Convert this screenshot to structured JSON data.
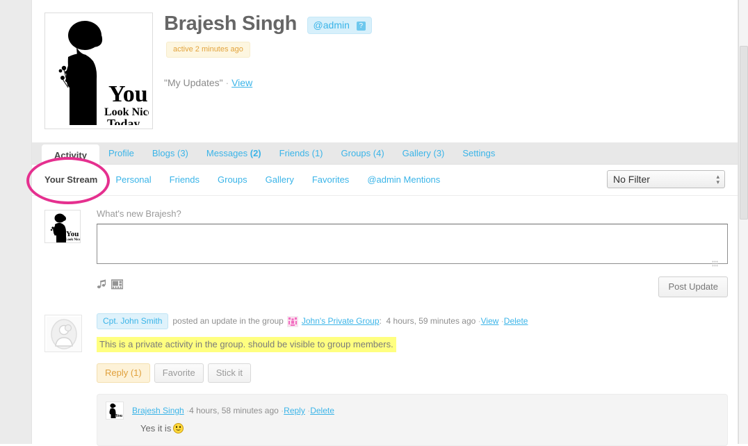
{
  "profile": {
    "name": "Brajesh Singh",
    "handle": "@admin",
    "handle_help": "?",
    "activity_status": "active 2 minutes ago",
    "updates_label": "\"My Updates\"",
    "updates_sep": "·",
    "updates_view": "View",
    "avatar_alt": "You Look Nice Today",
    "avatar_text_1": "You",
    "avatar_text_2": "Look Nice"
  },
  "tabs": [
    {
      "label": "Activity",
      "count": "",
      "active": true
    },
    {
      "label": "Profile",
      "count": "",
      "active": false
    },
    {
      "label": "Blogs",
      "count": "(3)",
      "active": false
    },
    {
      "label": "Messages",
      "count": "(2)",
      "active": false,
      "bold_count": true
    },
    {
      "label": "Friends",
      "count": "(1)",
      "active": false
    },
    {
      "label": "Groups",
      "count": "(4)",
      "active": false
    },
    {
      "label": "Gallery",
      "count": "(3)",
      "active": false
    },
    {
      "label": "Settings",
      "count": "",
      "active": false
    }
  ],
  "subtabs": [
    {
      "label": "Your Stream",
      "active": true
    },
    {
      "label": "Personal",
      "active": false
    },
    {
      "label": "Friends",
      "active": false
    },
    {
      "label": "Groups",
      "active": false
    },
    {
      "label": "Gallery",
      "active": false
    },
    {
      "label": "Favorites",
      "active": false
    },
    {
      "label": "@admin Mentions",
      "active": false
    }
  ],
  "filter": {
    "selected": "No Filter",
    "options": [
      "No Filter"
    ],
    "arrow_icon": "updown-arrow-icon"
  },
  "post_form": {
    "label": "What's new Brajesh?",
    "textarea_value": "",
    "textarea_placeholder": "",
    "music_icon": "music-note-icon",
    "video_icon": "video-clip-icon",
    "submit_label": "Post Update"
  },
  "activity": {
    "author": "Cpt. John Smith",
    "action_text": "posted an update in the group",
    "group_name": "John's Private Group",
    "group_colon": ":",
    "timestamp": "4 hours, 59 minutes ago",
    "sep": "·",
    "view_label": "View",
    "delete_label": "Delete",
    "content": "This is a private activity in the group. should be visible to group members.",
    "actions": [
      {
        "label": "Reply (1)",
        "style": "reply"
      },
      {
        "label": "Favorite",
        "style": "plain"
      },
      {
        "label": "Stick it",
        "style": "plain"
      }
    ],
    "comment": {
      "author": "Brajesh Singh",
      "timestamp": "4 hours, 58 minutes ago",
      "reply_label": "Reply",
      "delete_label": "Delete",
      "sep": "·",
      "text": "Yes it is",
      "emoji": "smiley-face-icon"
    }
  },
  "annotation": {
    "shape": "ellipse",
    "color": "#e5308f",
    "target": "Your Stream"
  },
  "colors": {
    "link": "#3ab4e8",
    "highlight": "#ffff80",
    "annotation": "#e5308f",
    "tabbar": "#e8e8e8"
  }
}
